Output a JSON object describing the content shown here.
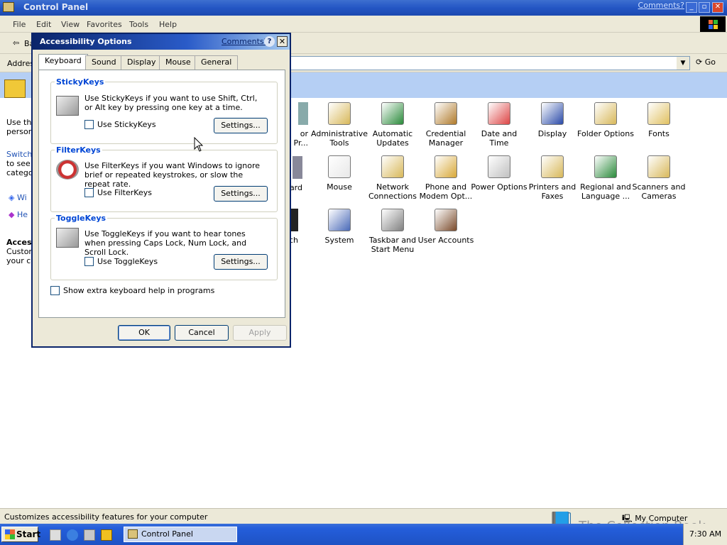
{
  "window": {
    "title": "Control Panel",
    "comments_link": "Comments?",
    "min": "_",
    "restore": "▫",
    "close": "✕"
  },
  "menu": [
    "File",
    "Edit",
    "View",
    "Favorites",
    "Tools",
    "Help"
  ],
  "toolbar": {
    "back_partial": "Ba"
  },
  "address": {
    "label_partial": "Addres",
    "go": "Go"
  },
  "left_pane": {
    "text1": "Use the",
    "text2": "person.",
    "switch1": "Switch",
    "switch2": "to see i",
    "switch3": "categor",
    "link1": "Wi",
    "link2": "He",
    "access": "Acces",
    "custom": "Custom",
    "yourco": "your co"
  },
  "icons": [
    {
      "name": "Administrative Tools",
      "l1": "Administrative",
      "l2": "Tools",
      "c": "#d8b85a"
    },
    {
      "name": "Automatic Updates",
      "l1": "Automatic",
      "l2": "Updates",
      "c": "#2a8a3a"
    },
    {
      "name": "Credential Manager",
      "l1": "Credential",
      "l2": "Manager",
      "c": "#b07a2a"
    },
    {
      "name": "Date and Time",
      "l1": "Date and Time",
      "l2": "",
      "c": "#d44"
    },
    {
      "name": "Display",
      "l1": "Display",
      "l2": "",
      "c": "#2a4aa8"
    },
    {
      "name": "Folder Options",
      "l1": "Folder Options",
      "l2": "",
      "c": "#d8b85a"
    },
    {
      "name": "Fonts",
      "l1": "Fonts",
      "l2": "",
      "c": "#e0c060"
    },
    {
      "name": "Mouse",
      "l1": "Mouse",
      "l2": "",
      "c": "#e8e8e8"
    },
    {
      "name": "Network Connections",
      "l1": "Network",
      "l2": "Connections",
      "c": "#d8b85a"
    },
    {
      "name": "Phone and Modem Options",
      "l1": "Phone and",
      "l2": "Modem Opt...",
      "c": "#d8a838"
    },
    {
      "name": "Power Options",
      "l1": "Power Options",
      "l2": "",
      "c": "#c0c0c0"
    },
    {
      "name": "Printers and Faxes",
      "l1": "Printers and",
      "l2": "Faxes",
      "c": "#d8b85a"
    },
    {
      "name": "Regional and Language Options",
      "l1": "Regional and",
      "l2": "Language ...",
      "c": "#2a8a3a"
    },
    {
      "name": "Scanners and Cameras",
      "l1": "Scanners and",
      "l2": "Cameras",
      "c": "#d8b85a"
    },
    {
      "name": "System",
      "l1": "System",
      "l2": "",
      "c": "#4a6ab8"
    },
    {
      "name": "Taskbar and Start Menu",
      "l1": "Taskbar and",
      "l2": "Start Menu",
      "c": "#808080"
    },
    {
      "name": "User Accounts",
      "l1": "User Accounts",
      "l2": "",
      "c": "#7a4a2a"
    }
  ],
  "partial_icons": [
    {
      "l1": "or",
      "l2": "Pr..."
    },
    {
      "l1": "ard",
      "l2": ""
    },
    {
      "l1": "ch",
      "l2": ""
    }
  ],
  "status": {
    "text": "Customizes accessibility features for your computer",
    "computer": "My Computer"
  },
  "taskbar": {
    "start": "Start",
    "task": "Control Panel",
    "clock": "7:30 AM"
  },
  "watermark": "The Collection Book",
  "dialog": {
    "title": "Accessibility Options",
    "comments": "Comments?",
    "help": "?",
    "close": "✕",
    "tabs": [
      "Keyboard",
      "Sound",
      "Display",
      "Mouse",
      "General"
    ],
    "sticky": {
      "title": "StickyKeys",
      "desc": "Use StickyKeys if you want to use Shift, Ctrl, or Alt key by pressing one key at a time.",
      "check": "Use StickyKeys",
      "checked": false,
      "settings": "Settings..."
    },
    "filter": {
      "title": "FilterKeys",
      "desc": "Use FilterKeys if you want Windows to ignore brief or repeated keystrokes, or slow the repeat rate.",
      "check": "Use FilterKeys",
      "checked": false,
      "settings": "Settings..."
    },
    "toggle": {
      "title": "ToggleKeys",
      "desc": "Use ToggleKeys if you want to hear tones when pressing Caps Lock, Num Lock, and Scroll Lock.",
      "check": "Use ToggleKeys",
      "checked": false,
      "settings": "Settings..."
    },
    "extra": {
      "label": "Show extra keyboard help in programs",
      "checked": false
    },
    "ok": "OK",
    "cancel": "Cancel",
    "apply": "Apply"
  }
}
